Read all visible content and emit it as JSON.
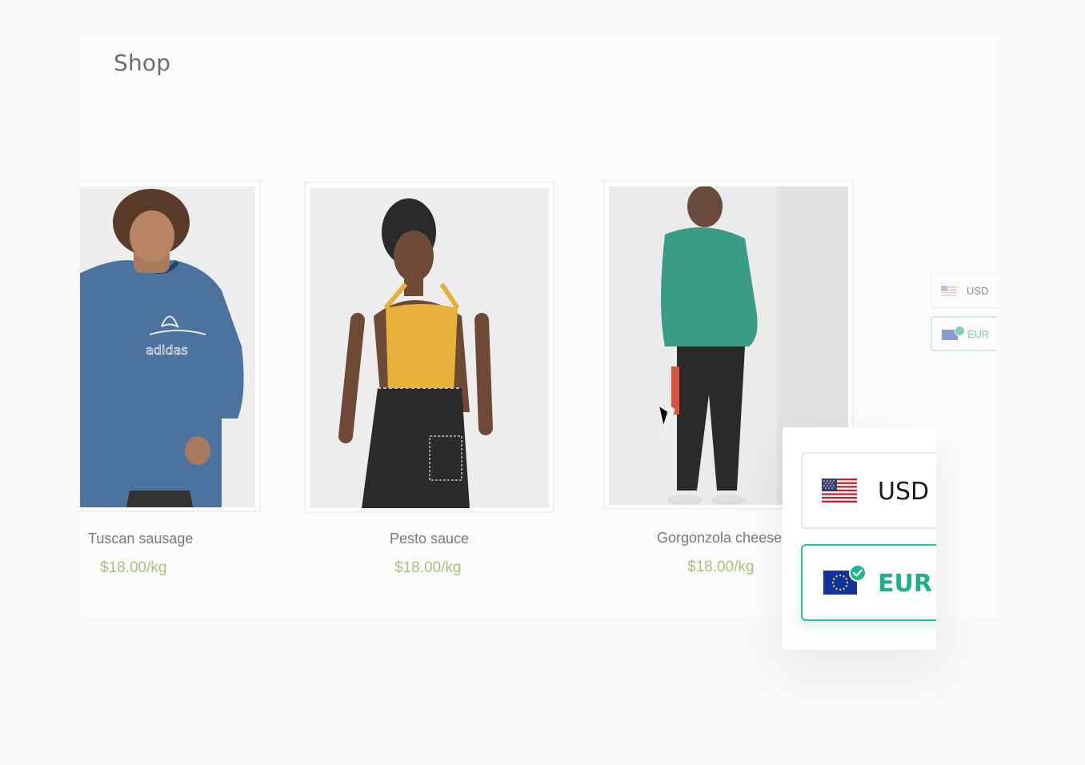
{
  "page": {
    "title": "Shop"
  },
  "products": [
    {
      "name": "Tuscan sausage",
      "price": "$18.00/kg",
      "image": "man-blue-adidas-tshirt"
    },
    {
      "name": "Pesto sauce",
      "price": "$18.00/kg",
      "image": "woman-yellow-top-black-skirt"
    },
    {
      "name": "Gorgonzola cheese",
      "price": "$18.00/kg",
      "image": "man-green-hoodie-black-pants"
    }
  ],
  "side_switcher": {
    "options": [
      {
        "code": "USD",
        "flag": "us-flag-icon",
        "selected": false
      },
      {
        "code": "EUR",
        "flag": "eu-flag-icon",
        "selected": true
      }
    ]
  },
  "currency_popup": {
    "options": [
      {
        "code": "USD",
        "flag": "us-flag-icon",
        "selected": false
      },
      {
        "code": "EUR",
        "flag": "eu-flag-icon",
        "selected": true
      }
    ]
  },
  "colors": {
    "price": "#a7c277",
    "accent": "#1fb08b",
    "accent_border": "#2dbf97",
    "text_muted": "#7a7a7a"
  }
}
